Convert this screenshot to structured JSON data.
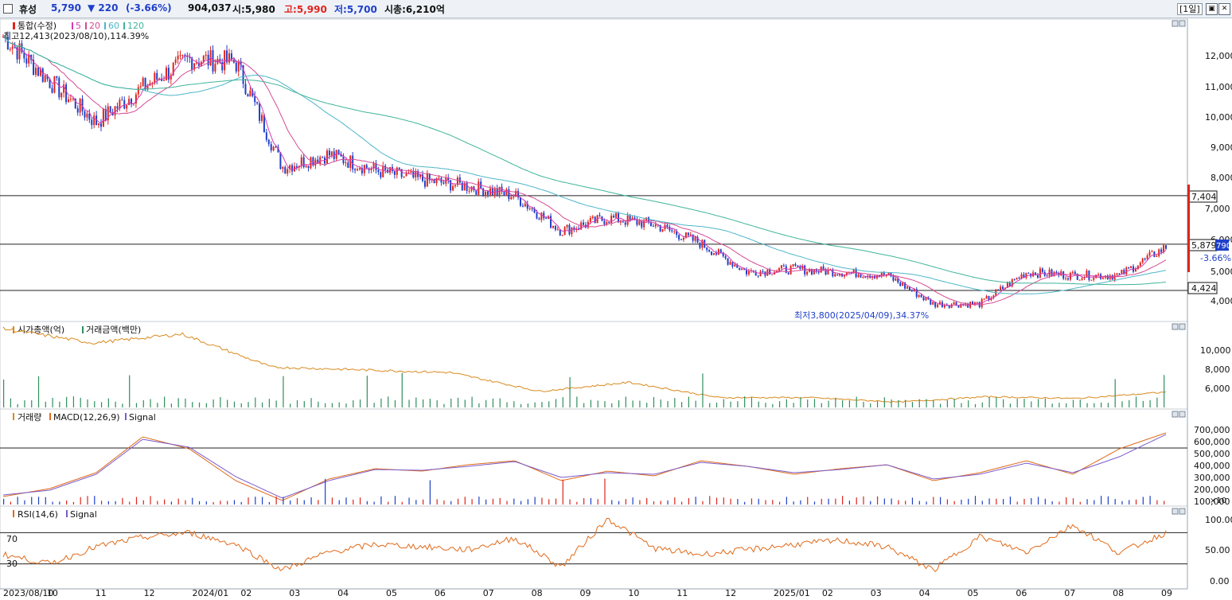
{
  "titlebar": {
    "name": "휴성",
    "price": "5,790",
    "change": "▼ 220",
    "change_pct": "(-3.66%)",
    "volume": "904,037",
    "open": "시:5,980",
    "high": "고:5,990",
    "low": "저:5,700",
    "mktcap": "시총:6,210억",
    "period": "[1일]",
    "restore_btn": "▣",
    "close_btn": "✕"
  },
  "colors": {
    "up": "#e0241c",
    "down": "#1f3fc9",
    "ma5": "#d63ab0",
    "ma20": "#d54b93",
    "ma60": "#4db6c8",
    "ma120": "#3fb49a",
    "cap": "#d98a1e",
    "amount": "#2f8f5c",
    "macd": "#e06a1a",
    "signal": "#7b5cc9",
    "rsi": "#e06a1a",
    "rsi_signal": "#7b5cc9"
  },
  "panes": {
    "price": {
      "legend_title": "통합(수정)",
      "legend_ma": [
        "5",
        "20",
        "60",
        "120"
      ],
      "high_note": "최고12,413(2023/08/10),114.39%",
      "low_note": "최저3,800(2025/04/09),34.37%",
      "yticks": [
        "12,000",
        "11,000",
        "10,000",
        "9,000",
        "8,000",
        "7,000",
        "6,000",
        "5,000",
        "4,000"
      ],
      "hline_labels": [
        "7,404",
        "5,879",
        "4,424"
      ],
      "last_label": "790",
      "last_pct": "-3.66%"
    },
    "cap": {
      "legend": [
        "시가총액(억)",
        "거래금액(백만)"
      ],
      "yticks": [
        "10,000",
        "8,000",
        "6,000"
      ]
    },
    "macd": {
      "legend": [
        "거래량",
        "MACD(12,26,9)",
        "Signal"
      ],
      "yticks": [
        "700,000",
        "600,000",
        "500,000",
        "400,000",
        "300,000",
        "200,000",
        "100,000"
      ],
      "unit": "×10"
    },
    "rsi": {
      "legend": [
        "RSI(14,6)",
        "Signal"
      ],
      "levels": [
        "70",
        "30"
      ],
      "yticks": [
        "100.00",
        "50.00",
        "0.00"
      ]
    }
  },
  "xaxis": [
    "2023/08/10",
    "10",
    "11",
    "12",
    "2024/01",
    "02",
    "03",
    "04",
    "05",
    "06",
    "07",
    "08",
    "09",
    "10",
    "11",
    "12",
    "2025/01",
    "02",
    "03",
    "04",
    "05",
    "06",
    "07",
    "08",
    "09"
  ],
  "chart_data": [
    {
      "type": "line",
      "title": "휴성 통합(수정) 일봉",
      "x": [
        "2023/08",
        "2023/09",
        "2023/10",
        "2023/11",
        "2023/12",
        "2024/01",
        "2024/02",
        "2024/03",
        "2024/04",
        "2024/05",
        "2024/06",
        "2024/07",
        "2024/08",
        "2024/09",
        "2024/10",
        "2024/11",
        "2024/12",
        "2025/01",
        "2025/02",
        "2025/03",
        "2025/04",
        "2025/05",
        "2025/06",
        "2025/07",
        "2025/08",
        "2025/09"
      ],
      "series": [
        {
          "name": "통합(수정)",
          "values": [
            12413,
            11000,
            9700,
            10800,
            11700,
            11600,
            8300,
            8700,
            8200,
            7900,
            7700,
            7400,
            6300,
            6700,
            6500,
            5900,
            5000,
            5100,
            5000,
            4900,
            4000,
            4000,
            5000,
            4900,
            4900,
            5790
          ]
        }
      ],
      "hlines": [
        7404,
        5879,
        4424
      ],
      "ylim": [
        3500,
        12800
      ],
      "ylabel": "",
      "xlabel": ""
    },
    {
      "type": "line",
      "title": "시가총액(억)",
      "x": [
        "2023/08",
        "2023/10",
        "2023/12",
        "2024/02",
        "2024/04",
        "2024/06",
        "2024/08",
        "2024/10",
        "2024/12",
        "2025/02",
        "2025/04",
        "2025/06",
        "2025/08",
        "2025/09"
      ],
      "series": [
        {
          "name": "시가총액(억)",
          "values": [
            13300,
            11700,
            12700,
            9000,
            8700,
            8400,
            6300,
            7300,
            5600,
            5600,
            5100,
            5700,
            5500,
            6210
          ]
        }
      ],
      "ylim": [
        4500,
        12500
      ]
    },
    {
      "type": "line",
      "title": "MACD(12,26,9)",
      "series": [
        {
          "name": "MACD(12,26,9)",
          "values": [
            0.1,
            0.2,
            0.4,
            0.85,
            0.7,
            0.3,
            0.05,
            0.32,
            0.45,
            0.42,
            0.5,
            0.55,
            0.3,
            0.42,
            0.36,
            0.55,
            0.48,
            0.38,
            0.45,
            0.5,
            0.3,
            0.4,
            0.55,
            0.38,
            0.7,
            0.9
          ]
        },
        {
          "name": "Signal",
          "values": [
            0.12,
            0.18,
            0.38,
            0.82,
            0.72,
            0.35,
            0.08,
            0.3,
            0.44,
            0.43,
            0.48,
            0.54,
            0.34,
            0.4,
            0.38,
            0.53,
            0.48,
            0.4,
            0.44,
            0.5,
            0.32,
            0.38,
            0.52,
            0.4,
            0.6,
            0.88
          ]
        }
      ],
      "ylim": [
        0,
        1
      ]
    },
    {
      "type": "line",
      "title": "RSI(14,6)",
      "series": [
        {
          "name": "RSI(14,6)",
          "values": [
            42,
            30,
            52,
            64,
            70,
            55,
            22,
            45,
            55,
            52,
            48,
            63,
            26,
            88,
            50,
            42,
            48,
            55,
            60,
            52,
            22,
            65,
            45,
            80,
            44,
            70
          ]
        }
      ],
      "levels": [
        70,
        30
      ],
      "ylim": [
        0,
        100
      ]
    }
  ]
}
